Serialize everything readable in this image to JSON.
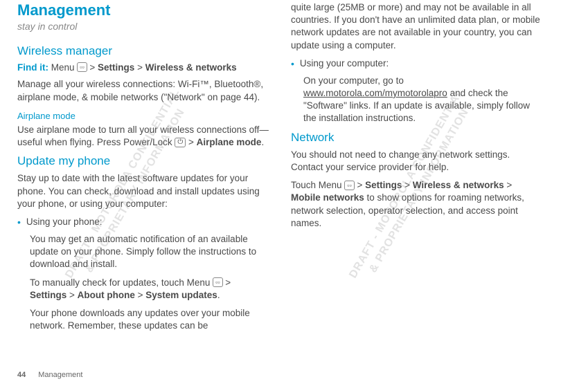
{
  "title": "Management",
  "subtitle": "stay in control",
  "wireless": {
    "heading": "Wireless manager",
    "findit_label": "Find it:",
    "findit_text1": " Menu ",
    "findit_text2": " > ",
    "findit_bold1": "Settings",
    "findit_text3": " > ",
    "findit_bold2": "Wireless & networks",
    "para": "Manage all your wireless connections: Wi-Fi™, Bluetooth®, airplane mode, & mobile networks (\"Network\" on page 44)."
  },
  "airplane": {
    "heading": "Airplane mode",
    "para1": "Use airplane mode to turn all your wireless connections off—useful when flying. Press Power/Lock ",
    "para2": " > ",
    "bold": "Airplane mode",
    "para3": "."
  },
  "update": {
    "heading": "Update my phone",
    "para": "Stay up to date with the latest software updates for your phone. You can check, download and install updates using your phone, or using your computer:",
    "bullet1": "Using your phone:",
    "b1_p1": "You may get an automatic notification of an available update on your phone. Simply follow the instructions to download and install.",
    "b1_p2a": "To manually check for updates, touch Menu ",
    "b1_p2b": " > ",
    "b1_bold1": "Settings",
    "b1_p2c": " > ",
    "b1_bold2": "About phone",
    "b1_p2d": " > ",
    "b1_bold3": "System updates",
    "b1_p2e": ".",
    "b1_p3": "Your phone downloads any updates over your mobile network. Remember, these updates can be ",
    "b1_p3_cont": "quite large (25MB or more) and may not be available in all countries. If you don't have an unlimited data plan, or mobile network updates are not available in your country, you can update using a computer.",
    "bullet2": "Using your computer:",
    "b2_p1a": "On your computer, go to ",
    "b2_link": "www.motorola.com/mymotorolapro",
    "b2_p1b": " and check the \"Software\" links. If an update is available, simply follow the installation instructions."
  },
  "network": {
    "heading": "Network",
    "para1": "You should not need to change any network settings. Contact your service provider for help.",
    "para2a": "Touch Menu ",
    "para2b": " > ",
    "bold1": "Settings",
    "para2c": " > ",
    "bold2": "Wireless & networks",
    "para2d": " > ",
    "bold3": "Mobile networks",
    "para2e": " to show options for roaming networks, network selection, operator selection, and access point names."
  },
  "footer": {
    "page": "44",
    "section": "Management"
  },
  "icons": {
    "menu": "▫▫",
    "power": "⏻"
  },
  "watermark": "DRAFT - MOTOROLA CONFIDENTIAL\n& PROPRIETARY INFORMATION"
}
